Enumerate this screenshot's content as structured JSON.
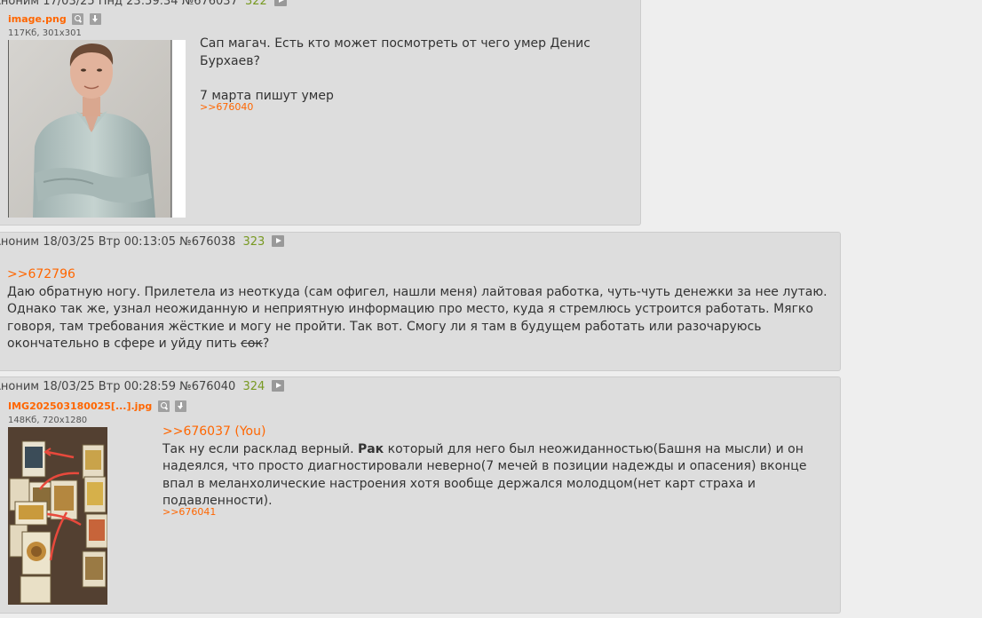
{
  "posts": [
    {
      "author": "Аноним",
      "date": "17/03/25 Пнд 23:59:34",
      "number": "№676037",
      "count": "322",
      "file": {
        "name": "image.png",
        "meta": "117Кб, 301x301"
      },
      "body": {
        "line1": "Сап магач. Есть кто может посмотреть от чего умер Денис Бурхаев?",
        "line2": "7 марта пишут умер"
      },
      "reply": ">>676040"
    },
    {
      "author": "Аноним",
      "date": "18/03/25 Втр 00:13:05",
      "number": "№676038",
      "count": "323",
      "quote_link": ">>672796",
      "body": {
        "text_a": "Даю обратную ногу. Прилетела из неоткуда (сам офигел, нашли меня) лайтовая работка, чуть-чуть денежки за нее лутаю. Однако так же, узнал неожиданную и неприятную информацию про место, куда я стремлюсь устроится работать. Мягко говоря, там требования жёсткие и могу не пройти. Так вот. Смогу ли я там в будущем работать или разочаруюсь окончательно в сфере и уйду пить ",
        "strike": "сок",
        "text_b": "?"
      }
    },
    {
      "author": "Аноним",
      "date": "18/03/25 Втр 00:28:59",
      "number": "№676040",
      "count": "324",
      "file": {
        "name": "IMG202503180025[...].jpg",
        "meta": "148Кб, 720x1280"
      },
      "quote_link": ">>676037 (You)",
      "body": {
        "text_a": "Так ну если расклад верный. ",
        "bold": "Рак",
        "text_b": " который для него был неожиданностью(Башня на мысли) и он надеялся, что просто диагностировали неверно(7 мечей в позиции надежды и опасения) вконце впал в меланхолические настроения хотя вообще держался молодцом(нет карт страха и подавленности)."
      },
      "reply": ">>676041"
    }
  ],
  "colors": {
    "background": "#eeeeee",
    "post": "#dddddd",
    "link": "#ff6600",
    "count": "#789922"
  }
}
